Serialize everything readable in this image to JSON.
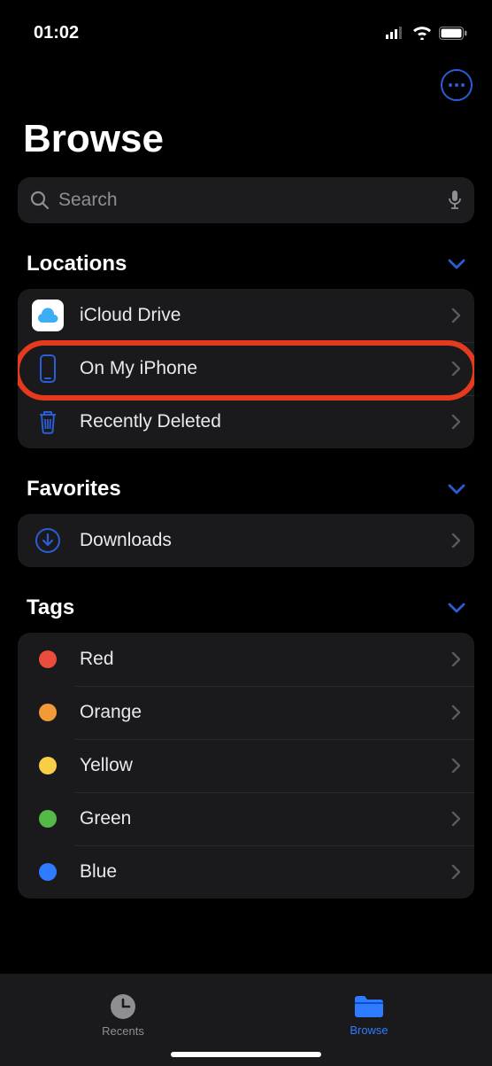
{
  "status": {
    "time": "01:02"
  },
  "title": "Browse",
  "search": {
    "placeholder": "Search"
  },
  "sections": {
    "locations": {
      "title": "Locations",
      "items": [
        {
          "label": "iCloud Drive",
          "icon": "icloud"
        },
        {
          "label": "On My iPhone",
          "icon": "iphone",
          "highlighted": true
        },
        {
          "label": "Recently Deleted",
          "icon": "trash"
        }
      ]
    },
    "favorites": {
      "title": "Favorites",
      "items": [
        {
          "label": "Downloads",
          "icon": "download"
        }
      ]
    },
    "tags": {
      "title": "Tags",
      "items": [
        {
          "label": "Red",
          "color": "#eb4d3d"
        },
        {
          "label": "Orange",
          "color": "#f19a37"
        },
        {
          "label": "Yellow",
          "color": "#f7ce46"
        },
        {
          "label": "Green",
          "color": "#54b948"
        },
        {
          "label": "Blue",
          "color": "#2f7bff"
        }
      ]
    }
  },
  "tabs": {
    "recents": "Recents",
    "browse": "Browse"
  },
  "colors": {
    "accent": "#2f7bff",
    "highlight": "#e63a1f"
  }
}
